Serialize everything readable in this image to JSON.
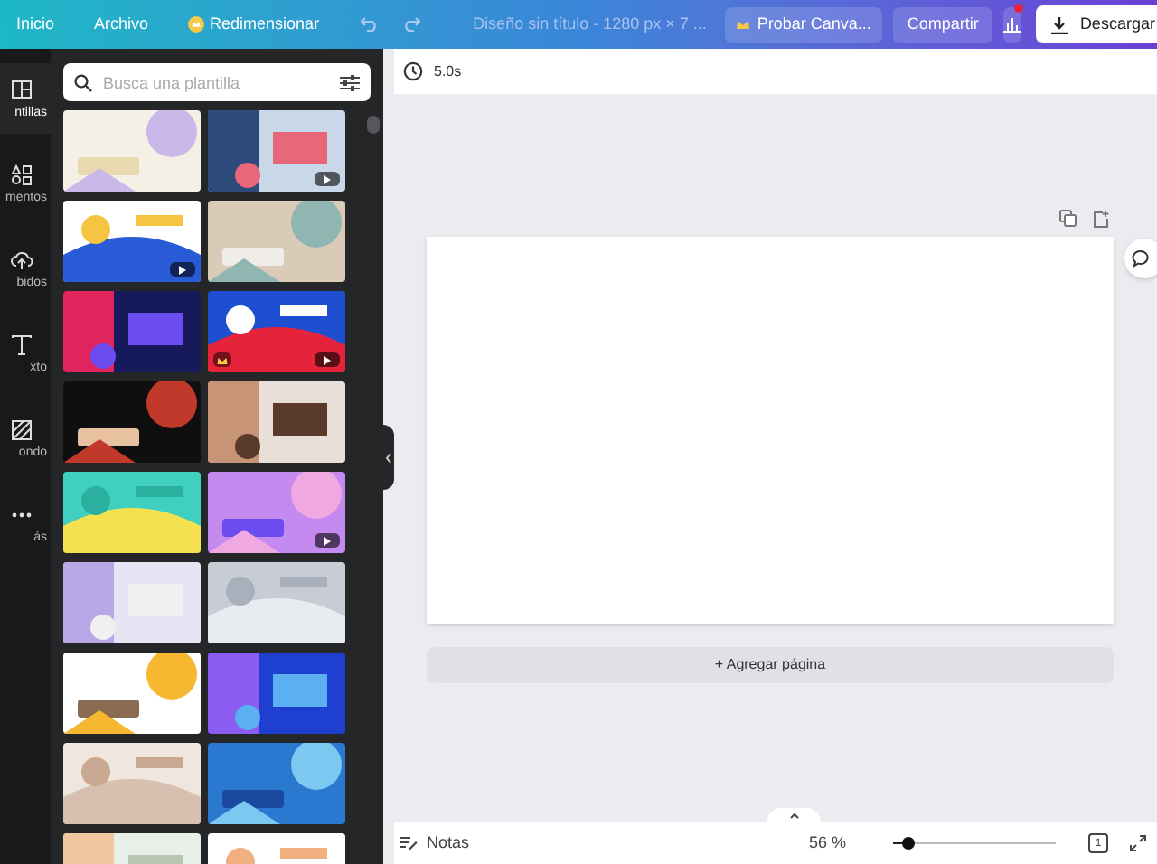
{
  "top_bar": {
    "items": [
      "Inicio",
      "Archivo",
      "Redimensionar"
    ],
    "title": "Diseño sin título - 1280 px × 7 ...",
    "try_button": "Probar Canva...",
    "share_button": "Compartir",
    "stats_notification": true,
    "download_button": "Descargar"
  },
  "side_rail": [
    {
      "label": "ntillas",
      "selected": true
    },
    {
      "label": "mentos",
      "selected": false
    },
    {
      "label": "bidos",
      "selected": false
    },
    {
      "label": "xto",
      "selected": false
    },
    {
      "label": "ondo",
      "selected": false
    },
    {
      "label": "ás",
      "selected": false
    }
  ],
  "search": {
    "placeholder": "Busca una plantilla"
  },
  "templates": [
    {
      "kind": "picture",
      "video": false,
      "premium": false
    },
    {
      "kind": "picture",
      "video": true,
      "premium": false
    },
    {
      "kind": "picture",
      "video": true,
      "premium": false
    },
    {
      "kind": "picture",
      "video": false,
      "premium": false
    },
    {
      "kind": "picture",
      "video": false,
      "premium": false
    },
    {
      "kind": "picture",
      "video": true,
      "premium": true
    },
    {
      "kind": "picture",
      "video": false,
      "premium": false
    },
    {
      "kind": "picture",
      "video": false,
      "premium": false
    },
    {
      "kind": "picture",
      "video": false,
      "premium": false
    },
    {
      "kind": "picture",
      "video": true,
      "premium": false
    },
    {
      "kind": "picture",
      "video": false,
      "premium": false
    },
    {
      "kind": "picture",
      "video": false,
      "premium": false
    },
    {
      "kind": "picture",
      "video": false,
      "premium": false
    },
    {
      "kind": "picture",
      "video": false,
      "premium": false
    },
    {
      "kind": "picture",
      "video": false,
      "premium": false
    },
    {
      "kind": "picture",
      "video": false,
      "premium": false
    },
    {
      "kind": "picture"
    },
    {
      "kind": "picture"
    }
  ],
  "page_toolbar": {
    "duration": "5.0s"
  },
  "add_page_button": "+ Agregar página",
  "bottom_bar": {
    "notes": "Notas",
    "zoom": "56 %",
    "zoom_slider": {
      "level": 0.09
    },
    "page_number": "1"
  }
}
